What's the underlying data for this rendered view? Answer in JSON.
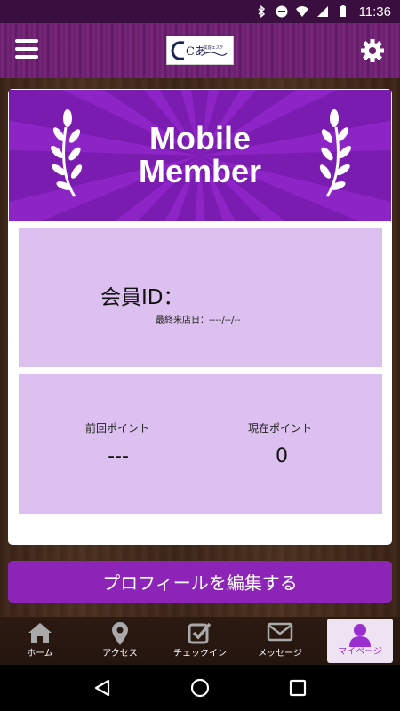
{
  "status_bar": {
    "time": "11:36",
    "icons": [
      "bluetooth-icon",
      "do-not-disturb-icon",
      "wifi-icon",
      "signal-icon",
      "battery-icon"
    ]
  },
  "header": {
    "logo_text": "Cあ",
    "logo_subtext": "美容エステ",
    "menu_icon": "hamburger-menu-icon",
    "settings_icon": "gear-icon",
    "background_color": "#6b1f6e"
  },
  "banner": {
    "line1": "Mobile",
    "line2": "Member",
    "color": "#8d25c6"
  },
  "member": {
    "id_label": "会員ID：",
    "last_visit": "最終来店日：----/--/--"
  },
  "points": {
    "previous_label": "前回ポイント",
    "previous_value": "---",
    "current_label": "現在ポイント",
    "current_value": "0"
  },
  "edit_profile_label": "プロフィールを編集する",
  "accent_color": "#8c24b8",
  "tabs": [
    {
      "label": "ホーム",
      "icon": "home-icon"
    },
    {
      "label": "アクセス",
      "icon": "map-pin-icon"
    },
    {
      "label": "チェックイン",
      "icon": "checkbox-icon"
    },
    {
      "label": "メッセージ",
      "icon": "envelope-icon"
    },
    {
      "label": "マイページ",
      "icon": "user-icon",
      "active": true
    }
  ],
  "nav": [
    "back-icon",
    "home-circle-icon",
    "recents-icon"
  ]
}
